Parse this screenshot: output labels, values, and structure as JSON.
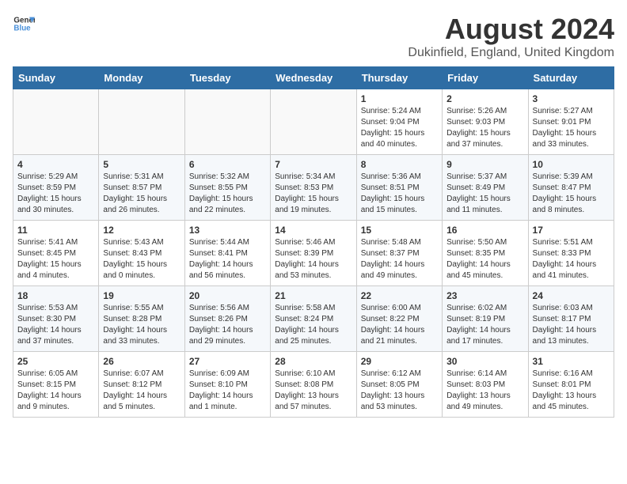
{
  "header": {
    "logo_line1": "General",
    "logo_line2": "Blue",
    "month_year": "August 2024",
    "location": "Dukinfield, England, United Kingdom"
  },
  "days_of_week": [
    "Sunday",
    "Monday",
    "Tuesday",
    "Wednesday",
    "Thursday",
    "Friday",
    "Saturday"
  ],
  "weeks": [
    [
      {
        "day": "",
        "info": ""
      },
      {
        "day": "",
        "info": ""
      },
      {
        "day": "",
        "info": ""
      },
      {
        "day": "",
        "info": ""
      },
      {
        "day": "1",
        "info": "Sunrise: 5:24 AM\nSunset: 9:04 PM\nDaylight: 15 hours\nand 40 minutes."
      },
      {
        "day": "2",
        "info": "Sunrise: 5:26 AM\nSunset: 9:03 PM\nDaylight: 15 hours\nand 37 minutes."
      },
      {
        "day": "3",
        "info": "Sunrise: 5:27 AM\nSunset: 9:01 PM\nDaylight: 15 hours\nand 33 minutes."
      }
    ],
    [
      {
        "day": "4",
        "info": "Sunrise: 5:29 AM\nSunset: 8:59 PM\nDaylight: 15 hours\nand 30 minutes."
      },
      {
        "day": "5",
        "info": "Sunrise: 5:31 AM\nSunset: 8:57 PM\nDaylight: 15 hours\nand 26 minutes."
      },
      {
        "day": "6",
        "info": "Sunrise: 5:32 AM\nSunset: 8:55 PM\nDaylight: 15 hours\nand 22 minutes."
      },
      {
        "day": "7",
        "info": "Sunrise: 5:34 AM\nSunset: 8:53 PM\nDaylight: 15 hours\nand 19 minutes."
      },
      {
        "day": "8",
        "info": "Sunrise: 5:36 AM\nSunset: 8:51 PM\nDaylight: 15 hours\nand 15 minutes."
      },
      {
        "day": "9",
        "info": "Sunrise: 5:37 AM\nSunset: 8:49 PM\nDaylight: 15 hours\nand 11 minutes."
      },
      {
        "day": "10",
        "info": "Sunrise: 5:39 AM\nSunset: 8:47 PM\nDaylight: 15 hours\nand 8 minutes."
      }
    ],
    [
      {
        "day": "11",
        "info": "Sunrise: 5:41 AM\nSunset: 8:45 PM\nDaylight: 15 hours\nand 4 minutes."
      },
      {
        "day": "12",
        "info": "Sunrise: 5:43 AM\nSunset: 8:43 PM\nDaylight: 15 hours\nand 0 minutes."
      },
      {
        "day": "13",
        "info": "Sunrise: 5:44 AM\nSunset: 8:41 PM\nDaylight: 14 hours\nand 56 minutes."
      },
      {
        "day": "14",
        "info": "Sunrise: 5:46 AM\nSunset: 8:39 PM\nDaylight: 14 hours\nand 53 minutes."
      },
      {
        "day": "15",
        "info": "Sunrise: 5:48 AM\nSunset: 8:37 PM\nDaylight: 14 hours\nand 49 minutes."
      },
      {
        "day": "16",
        "info": "Sunrise: 5:50 AM\nSunset: 8:35 PM\nDaylight: 14 hours\nand 45 minutes."
      },
      {
        "day": "17",
        "info": "Sunrise: 5:51 AM\nSunset: 8:33 PM\nDaylight: 14 hours\nand 41 minutes."
      }
    ],
    [
      {
        "day": "18",
        "info": "Sunrise: 5:53 AM\nSunset: 8:30 PM\nDaylight: 14 hours\nand 37 minutes."
      },
      {
        "day": "19",
        "info": "Sunrise: 5:55 AM\nSunset: 8:28 PM\nDaylight: 14 hours\nand 33 minutes."
      },
      {
        "day": "20",
        "info": "Sunrise: 5:56 AM\nSunset: 8:26 PM\nDaylight: 14 hours\nand 29 minutes."
      },
      {
        "day": "21",
        "info": "Sunrise: 5:58 AM\nSunset: 8:24 PM\nDaylight: 14 hours\nand 25 minutes."
      },
      {
        "day": "22",
        "info": "Sunrise: 6:00 AM\nSunset: 8:22 PM\nDaylight: 14 hours\nand 21 minutes."
      },
      {
        "day": "23",
        "info": "Sunrise: 6:02 AM\nSunset: 8:19 PM\nDaylight: 14 hours\nand 17 minutes."
      },
      {
        "day": "24",
        "info": "Sunrise: 6:03 AM\nSunset: 8:17 PM\nDaylight: 14 hours\nand 13 minutes."
      }
    ],
    [
      {
        "day": "25",
        "info": "Sunrise: 6:05 AM\nSunset: 8:15 PM\nDaylight: 14 hours\nand 9 minutes."
      },
      {
        "day": "26",
        "info": "Sunrise: 6:07 AM\nSunset: 8:12 PM\nDaylight: 14 hours\nand 5 minutes."
      },
      {
        "day": "27",
        "info": "Sunrise: 6:09 AM\nSunset: 8:10 PM\nDaylight: 14 hours\nand 1 minute."
      },
      {
        "day": "28",
        "info": "Sunrise: 6:10 AM\nSunset: 8:08 PM\nDaylight: 13 hours\nand 57 minutes."
      },
      {
        "day": "29",
        "info": "Sunrise: 6:12 AM\nSunset: 8:05 PM\nDaylight: 13 hours\nand 53 minutes."
      },
      {
        "day": "30",
        "info": "Sunrise: 6:14 AM\nSunset: 8:03 PM\nDaylight: 13 hours\nand 49 minutes."
      },
      {
        "day": "31",
        "info": "Sunrise: 6:16 AM\nSunset: 8:01 PM\nDaylight: 13 hours\nand 45 minutes."
      }
    ]
  ]
}
